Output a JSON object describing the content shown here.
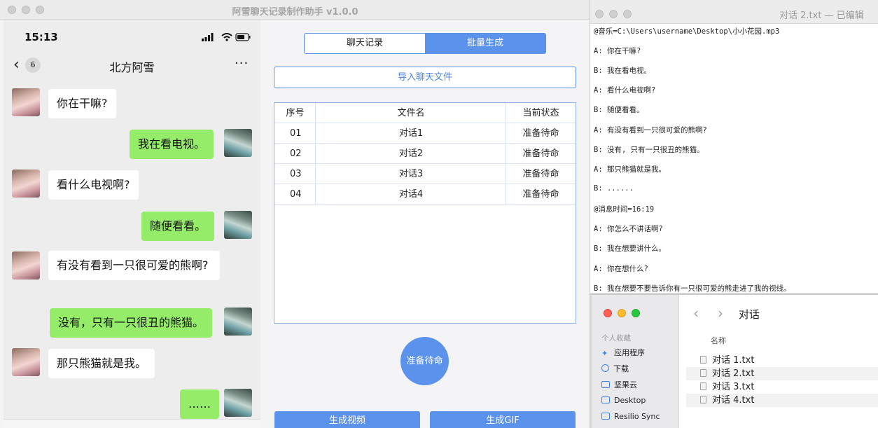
{
  "app": {
    "title": "阿雪聊天记录制作助手 v1.0.0"
  },
  "phone": {
    "status_time": "15:13",
    "back_badge": "6",
    "chat_title": "北方阿雪",
    "more": "···",
    "messages": [
      {
        "side": "left",
        "text": "你在干嘛?"
      },
      {
        "side": "right",
        "text": "我在看电视。"
      },
      {
        "side": "left",
        "text": "看什么电视啊?"
      },
      {
        "side": "right",
        "text": "随便看看。"
      },
      {
        "side": "left",
        "text": "有没有看到一只很可爱的熊啊?"
      },
      {
        "side": "right",
        "text": "没有，只有一只很丑的熊猫。"
      },
      {
        "side": "left",
        "text": "那只熊猫就是我。"
      },
      {
        "side": "right",
        "text": "……"
      }
    ]
  },
  "panel": {
    "tabs": [
      {
        "label": "聊天记录",
        "active": false
      },
      {
        "label": "批量生成",
        "active": true
      }
    ],
    "import_label": "导入聊天文件",
    "table": {
      "headers": [
        "序号",
        "文件名",
        "当前状态"
      ],
      "rows": [
        [
          "01",
          "对话1",
          "准备待命"
        ],
        [
          "02",
          "对话2",
          "准备待命"
        ],
        [
          "03",
          "对话3",
          "准备待命"
        ],
        [
          "04",
          "对话4",
          "准备待命"
        ]
      ]
    },
    "status_button": "准备待命",
    "video_button": "生成视频",
    "gif_button": "生成GIF"
  },
  "editor": {
    "title": "对话 2.txt — 已编辑",
    "lines": [
      "@音乐=C:\\Users\\username\\Desktop\\小小花园.mp3",
      "A: 你在干嘛?",
      "B: 我在看电视。",
      "A: 看什么电视啊?",
      "B: 随便看看。",
      "A: 有没有看到一只很可爱的熊啊?",
      "B: 没有, 只有一只很丑的熊猫。",
      "A: 那只熊猫就是我。",
      "B: ......",
      "@消息时间=16:19",
      "A: 你怎么不讲话啊?",
      "B: 我在想要讲什么。",
      "A: 你在想什么?",
      "B: 我在想要不要告诉你有一只很可爱的熊走进了我的视线。"
    ]
  },
  "finder": {
    "folder": "对话",
    "sidebar_heading": "个人收藏",
    "sidebar_items": [
      "应用程序",
      "下载",
      "坚果云",
      "Desktop",
      "Resilio Sync"
    ],
    "column_name": "名称",
    "files": [
      "对话 1.txt",
      "对话 2.txt",
      "对话 3.txt",
      "对话 4.txt"
    ]
  },
  "colors": {
    "accent": "#5b93ec",
    "bubble_right": "#95ec69",
    "bubble_left": "#ffffff"
  }
}
